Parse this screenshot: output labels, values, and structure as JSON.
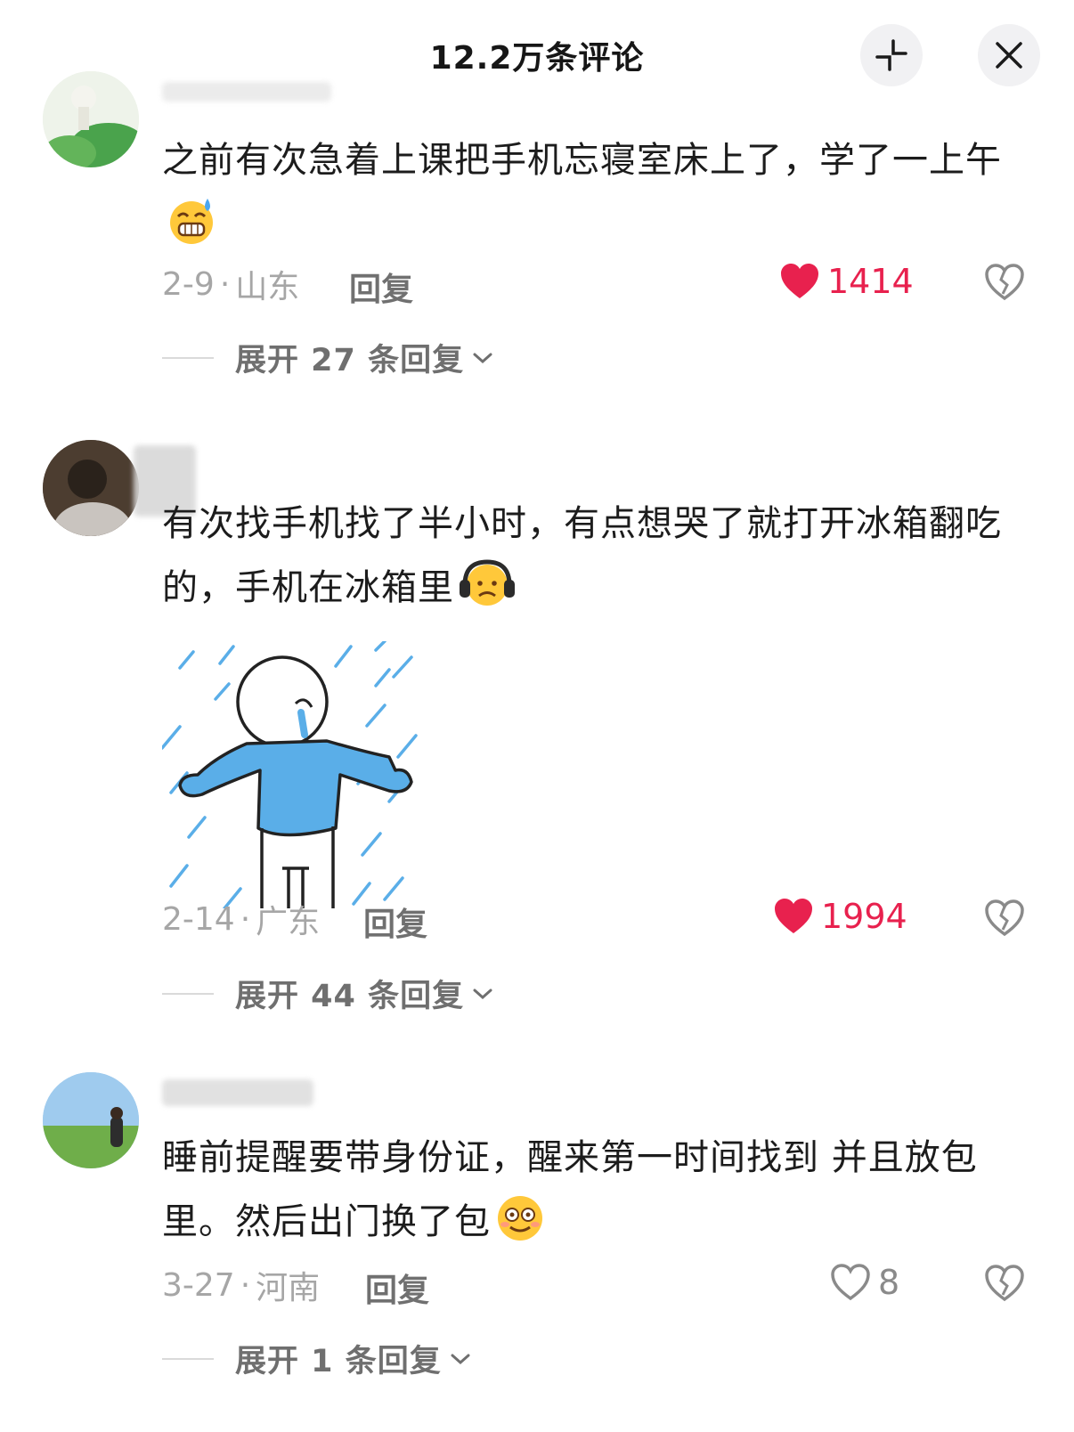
{
  "header": {
    "title": "12.2万条评论"
  },
  "comments": [
    {
      "text": "之前有次急着上课把手机忘寝室床上了，学了一上午",
      "date": "2-9",
      "location": "山东",
      "reply_label": "回复",
      "likes": "1414",
      "liked": true,
      "expand_label": "展开 27 条回复",
      "emoji": "grinning-sweat-emoji"
    },
    {
      "text": "有次找手机找了半小时，有点想哭了就打开冰箱翻吃的，手机在冰箱里",
      "date": "2-14",
      "location": "广东",
      "reply_label": "回复",
      "likes": "1994",
      "liked": true,
      "expand_label": "展开 44 条回复",
      "emoji": "headphones-frown-emoji",
      "sticker": "crying-in-rain-sticker"
    },
    {
      "text": "睡前提醒要带身份证，醒来第一时间找到 并且放包里。然后出门换了包",
      "date": "3-27",
      "location": "河南",
      "reply_label": "回复",
      "likes": "8",
      "liked": false,
      "expand_label": "展开 1 条回复",
      "emoji": "dazed-smile-emoji"
    }
  ],
  "colors": {
    "like_red": "#e8214e",
    "meta_gray": "#a6a6a6",
    "sticker_blue": "#5aaee8"
  }
}
